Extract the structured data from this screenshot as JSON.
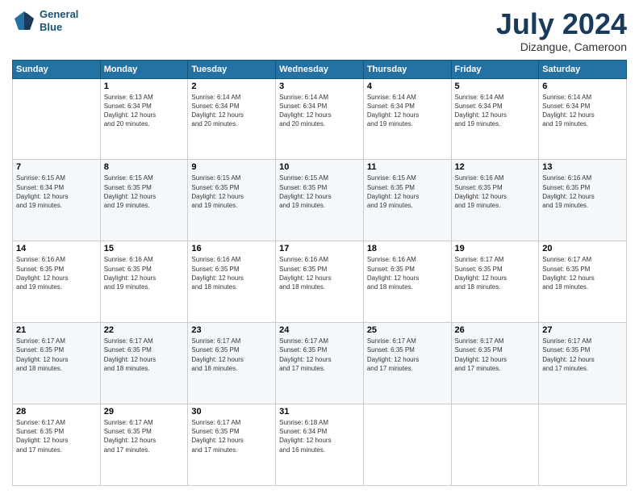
{
  "header": {
    "logo_line1": "General",
    "logo_line2": "Blue",
    "month": "July 2024",
    "location": "Dizangue, Cameroon"
  },
  "weekdays": [
    "Sunday",
    "Monday",
    "Tuesday",
    "Wednesday",
    "Thursday",
    "Friday",
    "Saturday"
  ],
  "weeks": [
    [
      {
        "day": "",
        "info": ""
      },
      {
        "day": "1",
        "info": "Sunrise: 6:13 AM\nSunset: 6:34 PM\nDaylight: 12 hours\nand 20 minutes."
      },
      {
        "day": "2",
        "info": "Sunrise: 6:14 AM\nSunset: 6:34 PM\nDaylight: 12 hours\nand 20 minutes."
      },
      {
        "day": "3",
        "info": "Sunrise: 6:14 AM\nSunset: 6:34 PM\nDaylight: 12 hours\nand 20 minutes."
      },
      {
        "day": "4",
        "info": "Sunrise: 6:14 AM\nSunset: 6:34 PM\nDaylight: 12 hours\nand 19 minutes."
      },
      {
        "day": "5",
        "info": "Sunrise: 6:14 AM\nSunset: 6:34 PM\nDaylight: 12 hours\nand 19 minutes."
      },
      {
        "day": "6",
        "info": "Sunrise: 6:14 AM\nSunset: 6:34 PM\nDaylight: 12 hours\nand 19 minutes."
      }
    ],
    [
      {
        "day": "7",
        "info": "Sunrise: 6:15 AM\nSunset: 6:34 PM\nDaylight: 12 hours\nand 19 minutes."
      },
      {
        "day": "8",
        "info": "Sunrise: 6:15 AM\nSunset: 6:35 PM\nDaylight: 12 hours\nand 19 minutes."
      },
      {
        "day": "9",
        "info": "Sunrise: 6:15 AM\nSunset: 6:35 PM\nDaylight: 12 hours\nand 19 minutes."
      },
      {
        "day": "10",
        "info": "Sunrise: 6:15 AM\nSunset: 6:35 PM\nDaylight: 12 hours\nand 19 minutes."
      },
      {
        "day": "11",
        "info": "Sunrise: 6:15 AM\nSunset: 6:35 PM\nDaylight: 12 hours\nand 19 minutes."
      },
      {
        "day": "12",
        "info": "Sunrise: 6:16 AM\nSunset: 6:35 PM\nDaylight: 12 hours\nand 19 minutes."
      },
      {
        "day": "13",
        "info": "Sunrise: 6:16 AM\nSunset: 6:35 PM\nDaylight: 12 hours\nand 19 minutes."
      }
    ],
    [
      {
        "day": "14",
        "info": "Sunrise: 6:16 AM\nSunset: 6:35 PM\nDaylight: 12 hours\nand 19 minutes."
      },
      {
        "day": "15",
        "info": "Sunrise: 6:16 AM\nSunset: 6:35 PM\nDaylight: 12 hours\nand 19 minutes."
      },
      {
        "day": "16",
        "info": "Sunrise: 6:16 AM\nSunset: 6:35 PM\nDaylight: 12 hours\nand 18 minutes."
      },
      {
        "day": "17",
        "info": "Sunrise: 6:16 AM\nSunset: 6:35 PM\nDaylight: 12 hours\nand 18 minutes."
      },
      {
        "day": "18",
        "info": "Sunrise: 6:16 AM\nSunset: 6:35 PM\nDaylight: 12 hours\nand 18 minutes."
      },
      {
        "day": "19",
        "info": "Sunrise: 6:17 AM\nSunset: 6:35 PM\nDaylight: 12 hours\nand 18 minutes."
      },
      {
        "day": "20",
        "info": "Sunrise: 6:17 AM\nSunset: 6:35 PM\nDaylight: 12 hours\nand 18 minutes."
      }
    ],
    [
      {
        "day": "21",
        "info": "Sunrise: 6:17 AM\nSunset: 6:35 PM\nDaylight: 12 hours\nand 18 minutes."
      },
      {
        "day": "22",
        "info": "Sunrise: 6:17 AM\nSunset: 6:35 PM\nDaylight: 12 hours\nand 18 minutes."
      },
      {
        "day": "23",
        "info": "Sunrise: 6:17 AM\nSunset: 6:35 PM\nDaylight: 12 hours\nand 18 minutes."
      },
      {
        "day": "24",
        "info": "Sunrise: 6:17 AM\nSunset: 6:35 PM\nDaylight: 12 hours\nand 17 minutes."
      },
      {
        "day": "25",
        "info": "Sunrise: 6:17 AM\nSunset: 6:35 PM\nDaylight: 12 hours\nand 17 minutes."
      },
      {
        "day": "26",
        "info": "Sunrise: 6:17 AM\nSunset: 6:35 PM\nDaylight: 12 hours\nand 17 minutes."
      },
      {
        "day": "27",
        "info": "Sunrise: 6:17 AM\nSunset: 6:35 PM\nDaylight: 12 hours\nand 17 minutes."
      }
    ],
    [
      {
        "day": "28",
        "info": "Sunrise: 6:17 AM\nSunset: 6:35 PM\nDaylight: 12 hours\nand 17 minutes."
      },
      {
        "day": "29",
        "info": "Sunrise: 6:17 AM\nSunset: 6:35 PM\nDaylight: 12 hours\nand 17 minutes."
      },
      {
        "day": "30",
        "info": "Sunrise: 6:17 AM\nSunset: 6:35 PM\nDaylight: 12 hours\nand 17 minutes."
      },
      {
        "day": "31",
        "info": "Sunrise: 6:18 AM\nSunset: 6:34 PM\nDaylight: 12 hours\nand 16 minutes."
      },
      {
        "day": "",
        "info": ""
      },
      {
        "day": "",
        "info": ""
      },
      {
        "day": "",
        "info": ""
      }
    ]
  ]
}
